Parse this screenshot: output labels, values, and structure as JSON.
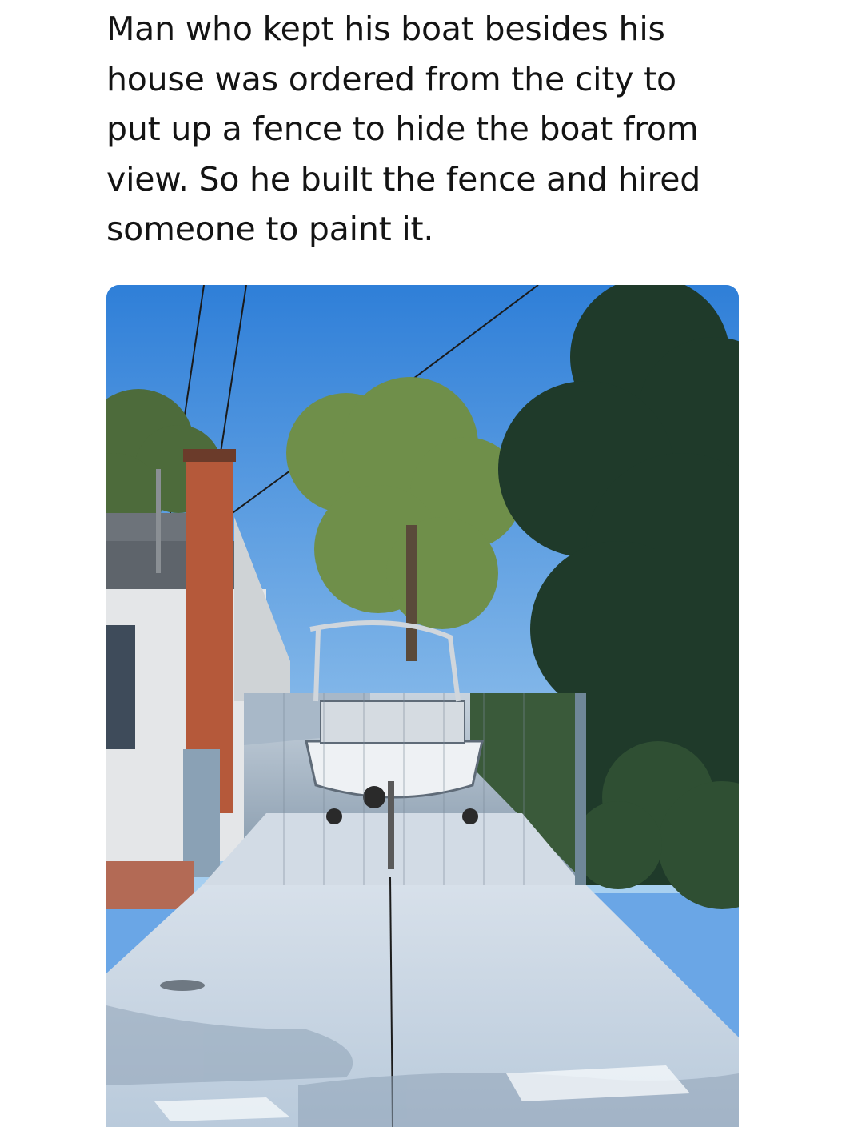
{
  "post": {
    "caption_lines": [
      "Man who kept his boat besides his",
      "house was ordered from the city to",
      "put up a fence to hide the boat from",
      "view. So he built the fence and hired",
      "someone to paint it."
    ]
  },
  "photo": {
    "subject": "painted-fence-boat-illusion-icon",
    "colors": {
      "sky_top": "#2f7fd8",
      "sky_bottom": "#9cc9ef",
      "concrete": "#c9d6e3",
      "brick": "#b5593a",
      "tree_dark": "#1f3a2a",
      "tree_light": "#6f8f4a",
      "fence": "#8aa3b8"
    }
  }
}
